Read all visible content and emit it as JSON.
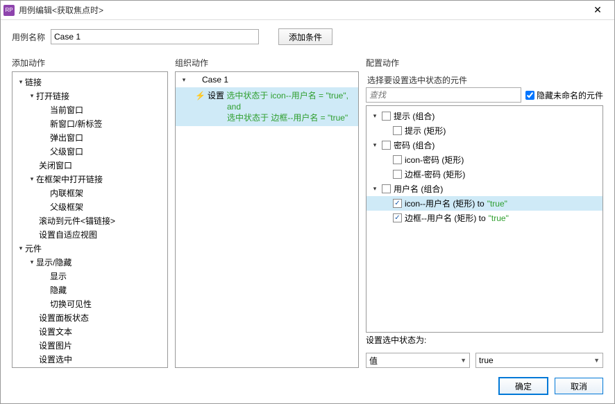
{
  "title": "用例编辑<获取焦点时>",
  "icon_text": "RP",
  "name_label": "用例名称",
  "name_value": "Case 1",
  "add_condition": "添加条件",
  "headers": {
    "add_action": "添加动作",
    "organize": "组织动作",
    "configure": "配置动作"
  },
  "actions_tree": {
    "group1": "链接",
    "open_link": "打开链接",
    "cur_win": "当前窗口",
    "new_win": "新窗口/新标签",
    "popup": "弹出窗口",
    "parent_win": "父级窗口",
    "close_win": "关闭窗口",
    "open_frame": "在框架中打开链接",
    "inline_frame": "内联框架",
    "parent_frame": "父级框架",
    "scroll_anchor": "滚动到元件<锚链接>",
    "set_adaptive": "设置自适应视图",
    "group2": "元件",
    "show_hide": "显示/隐藏",
    "show": "显示",
    "hide": "隐藏",
    "toggle_vis": "切换可见性",
    "set_panel": "设置面板状态",
    "set_text": "设置文本",
    "set_image": "设置图片",
    "set_selected": "设置选中"
  },
  "case": {
    "name": "Case 1",
    "action_label": "设置",
    "line1a": "选中状态于 icon--用户名 = \"true\",",
    "line1b": "and",
    "line2": "选中状态于 边框--用户名 = \"true\""
  },
  "cfg": {
    "select_widgets": "选择要设置选中状态的元件",
    "search_placeholder": "查找",
    "hide_unnamed": "隐藏未命名的元件",
    "items": {
      "tip_group": "提示 (组合)",
      "tip_rect": "提示 (矩形)",
      "pwd_group": "密码 (组合)",
      "icon_pwd": "icon-密码 (矩形)",
      "border_pwd": "边框-密码 (矩形)",
      "user_group": "用户名 (组合)",
      "icon_user_a": "icon--用户名 (矩形) to ",
      "icon_user_b": "\"true\"",
      "border_user_a": "边框--用户名 (矩形) to ",
      "border_user_b": "\"true\""
    },
    "set_state_label": "设置选中状态为:",
    "value_sel": "值",
    "true_sel": "true"
  },
  "buttons": {
    "ok": "确定",
    "cancel": "取消"
  }
}
